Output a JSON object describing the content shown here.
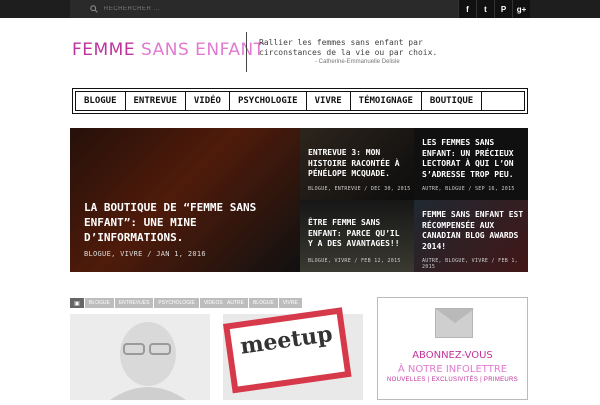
{
  "topbar": {
    "search_placeholder": "RECHERCHER ...",
    "social": [
      {
        "label": "f",
        "icon": "facebook-icon"
      },
      {
        "label": "t",
        "icon": "twitter-icon"
      },
      {
        "label": "P",
        "icon": "pinterest-icon"
      },
      {
        "label": "g+",
        "icon": "google-plus-icon"
      }
    ]
  },
  "header": {
    "brand_part1": "FEMME",
    "brand_part2": "SANS ENFANT",
    "tagline": "Rallier les femmes sans enfant par circonstances de la vie ou par choix.",
    "attribution": "- Catherine-Emmanuelle Delisle"
  },
  "nav": {
    "items": [
      "BLOGUE",
      "ENTREVUE",
      "VIDÉO",
      "PSYCHOLOGIE",
      "VIVRE",
      "TÉMOIGNAGE",
      "BOUTIQUE"
    ]
  },
  "featured": {
    "main": {
      "title": "LA BOUTIQUE DE “FEMME SANS ENFANT”: UNE MINE D’INFORMATIONS.",
      "meta": "BLOGUE, VIVRE / JAN 1, 2016"
    },
    "cards": [
      {
        "title": "ENTREVUE 3: MON HISTOIRE RACONTÉE À PÉNÉLOPE MCQUADE.",
        "meta": "BLOGUE, ENTREVUE / DEC 30, 2015"
      },
      {
        "title": "LES FEMMES SANS ENFANT: UN PRÉCIEUX LECTORAT À QUI L’ON S’ADRESSE TROP PEU.",
        "meta": "AUTRE, BLOGUE / SEP 16, 2015"
      },
      {
        "title": "ÊTRE FEMME SANS ENFANT: PARCE QU’IL Y A DES AVANTAGES!!",
        "meta": "BLOGUE, VIVRE / FEB 12, 2015"
      },
      {
        "title": "FEMME SANS ENFANT EST RÉCOMPENSÉE AUX CANADIAN BLOG AWARDS 2014!",
        "meta": "AUTRE, BLOGUE, VIVRE / FEB 1, 2015"
      }
    ]
  },
  "posts": {
    "post1_tags": [
      "BLOGUE",
      "ENTREVUES",
      "PSYCHOLOGIE",
      "VIDEOS"
    ],
    "post2_tags": [
      "AUTRE",
      "BLOGUE",
      "VIVRE"
    ],
    "meetup_text": "meetup"
  },
  "newsletter": {
    "title": "ABONNEZ-VOUS",
    "subtitle": "À NOTRE INFOLETTRE",
    "meta": "NOUVELLES | EXCLUSIVITÉS | PRIMEURS"
  }
}
